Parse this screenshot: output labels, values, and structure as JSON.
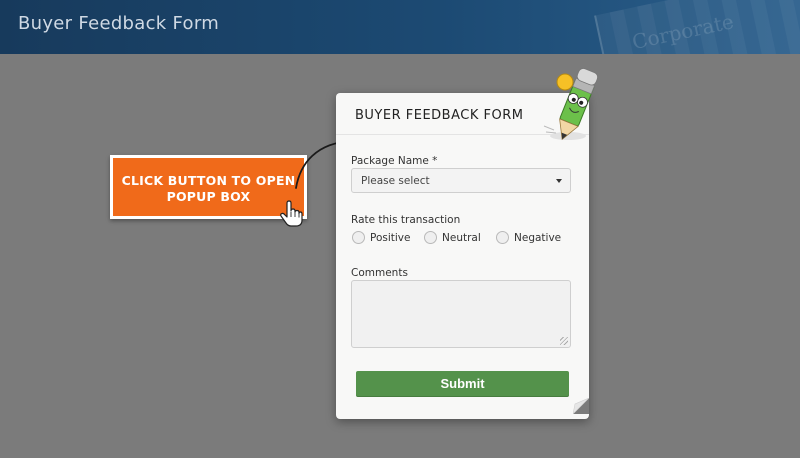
{
  "header": {
    "title": "Buyer Feedback Form",
    "decor_text": "Corporate"
  },
  "cta": {
    "label_line1": "CLICK BUTTON TO OPEN",
    "label_line2": "POPUP BOX"
  },
  "form": {
    "title": "BUYER FEEDBACK FORM",
    "package": {
      "label": "Package Name *",
      "value": "Please select"
    },
    "rating": {
      "label": "Rate this transaction",
      "options": [
        "Positive",
        "Neutral",
        "Negative"
      ]
    },
    "comments": {
      "label": "Comments",
      "value": ""
    },
    "submit_label": "Submit"
  },
  "colors": {
    "page_bg": "#7b7b7b",
    "header_bg": "#173a5c",
    "cta_bg": "#f06a1a",
    "submit_bg": "#54924b"
  },
  "icons": [
    "pencil-mascot-icon",
    "hand-pointer-icon",
    "curved-arrow-icon",
    "chevron-down-icon",
    "resize-grip-icon"
  ]
}
